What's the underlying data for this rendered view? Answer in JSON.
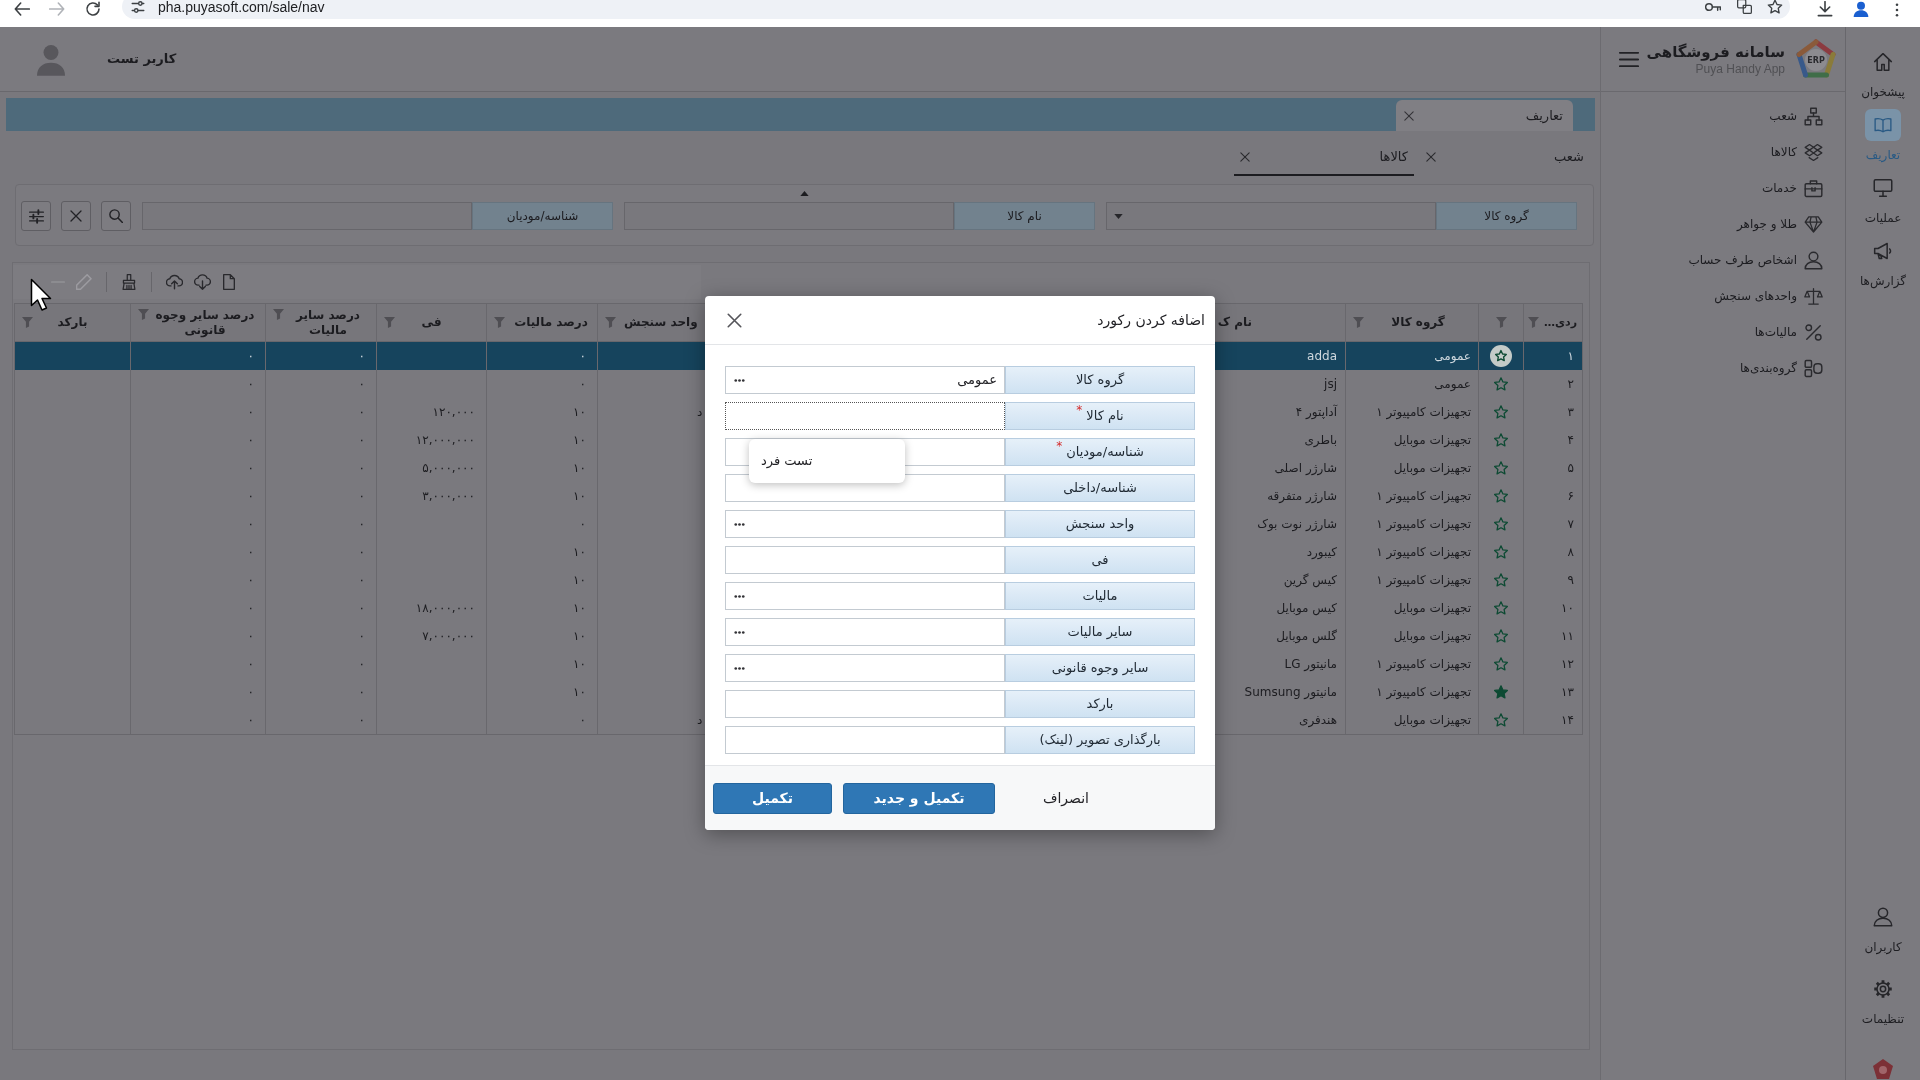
{
  "browser": {
    "url": "pha.puyasoft.com/sale/nav"
  },
  "brand": {
    "logo_text": "ERP",
    "title": "سامانه فروشگاهی",
    "subtitle": "Puya Handy App"
  },
  "rail": {
    "items": [
      {
        "label": "پیشخوان",
        "selected": false
      },
      {
        "label": "تعاریف",
        "selected": true
      },
      {
        "label": "عملیات",
        "selected": false
      },
      {
        "label": "گزارش‌ها",
        "selected": false
      }
    ],
    "bottom_items": [
      {
        "label": "کاربران",
        "selected": false
      },
      {
        "label": "تنظیمات",
        "selected": false
      }
    ]
  },
  "submenu": {
    "items": [
      "شعب",
      "کالاها",
      "خدمات",
      "طلا و جواهر",
      "اشخاص طرف حساب",
      "واحدهای سنجش",
      "مالیات‌ها",
      "گروه‌بندی‌ها"
    ]
  },
  "header": {
    "user_name": "کاربر تست"
  },
  "page_tabs": [
    {
      "label": "تعاریف",
      "selected": true
    }
  ],
  "sub_tabs": [
    {
      "label": "شعب",
      "selected": false
    },
    {
      "label": "کالاها",
      "selected": true
    }
  ],
  "filter": {
    "fields": [
      {
        "label": "گروه کالا",
        "kind": "dropdown"
      },
      {
        "label": "نام کالا",
        "kind": "text"
      },
      {
        "label": "شناسه/مودیان",
        "kind": "text"
      }
    ]
  },
  "toolbar": [
    {
      "disabled": true
    },
    {
      "disabled": true
    },
    {
      "disabled": false
    },
    {
      "disabled": false
    },
    {
      "disabled": false
    },
    {
      "disabled": false
    }
  ],
  "table": {
    "columns": [
      {
        "label": "ردی…",
        "filter": true
      },
      {
        "filter": true
      },
      {
        "label": "گروه کالا",
        "filter": true
      },
      {
        "label": "نام ک",
        "filter": false
      },
      {
        "label": "واحد سنجش",
        "filter": true
      },
      {
        "label": "درصد مالیات",
        "filter": true
      },
      {
        "label": "فی",
        "filter": true
      },
      {
        "label": "درصد سایر مالیات",
        "filter": true
      },
      {
        "label": "درصد سایر وجوه قانونی",
        "filter": true
      },
      {
        "label": "بارکد",
        "filter": true
      }
    ],
    "rows": [
      {
        "number": "۱",
        "favorite": false,
        "selected": true,
        "group": "عمومی",
        "name": "adda",
        "tax_percent": "۰",
        "other_tax_percent": "۰",
        "other_legal_percent": "۰"
      },
      {
        "number": "۲",
        "favorite": false,
        "selected": false,
        "group": "عمومی",
        "name": "jsj",
        "tax_percent": "۰",
        "other_tax_percent": "۰",
        "other_legal_percent": "۰"
      },
      {
        "number": "۳",
        "favorite": false,
        "selected": false,
        "group": "تجهیزات کامپیوتر ۱",
        "name": "آداپتور ۴",
        "unit": "د",
        "tax_percent": "۱۰",
        "price": "۱۲۰,۰۰۰",
        "other_tax_percent": "۰",
        "other_legal_percent": "۰"
      },
      {
        "number": "۴",
        "favorite": false,
        "selected": false,
        "group": "تجهیزات موبایل",
        "name": "باطری",
        "tax_percent": "۱۰",
        "price": "۱۲,۰۰۰,۰۰۰",
        "other_tax_percent": "۰",
        "other_legal_percent": "۰"
      },
      {
        "number": "۵",
        "favorite": false,
        "selected": false,
        "group": "تجهیزات موبایل",
        "name": "شارژر اصلی",
        "tax_percent": "۱۰",
        "price": "۵,۰۰۰,۰۰۰",
        "other_tax_percent": "۰",
        "other_legal_percent": "۰"
      },
      {
        "number": "۶",
        "favorite": false,
        "selected": false,
        "group": "تجهیزات کامپیوتر ۱",
        "name": "شارژر متفرقه",
        "tax_percent": "۱۰",
        "price": "۳,۰۰۰,۰۰۰",
        "other_tax_percent": "۰",
        "other_legal_percent": "۰"
      },
      {
        "number": "۷",
        "favorite": false,
        "selected": false,
        "group": "تجهیزات کامپیوتر ۱",
        "name": "شارژر نوت بوک",
        "tax_percent": "۰",
        "other_tax_percent": "۰",
        "other_legal_percent": "۰"
      },
      {
        "number": "۸",
        "favorite": false,
        "selected": false,
        "group": "تجهیزات کامپیوتر ۱",
        "name": "کیبورد",
        "tax_percent": "۱۰",
        "other_tax_percent": "۰",
        "other_legal_percent": "۰"
      },
      {
        "number": "۹",
        "favorite": false,
        "selected": false,
        "group": "تجهیزات کامپیوتر ۱",
        "name": "کیس گرین",
        "tax_percent": "۱۰",
        "other_tax_percent": "۰",
        "other_legal_percent": "۰"
      },
      {
        "number": "۱۰",
        "favorite": false,
        "selected": false,
        "group": "تجهیزات موبایل",
        "name": "کیس موبایل",
        "tax_percent": "۱۰",
        "price": "۱۸,۰۰۰,۰۰۰",
        "other_tax_percent": "۰",
        "other_legal_percent": "۰"
      },
      {
        "number": "۱۱",
        "favorite": false,
        "selected": false,
        "group": "تجهیزات موبایل",
        "name": "گلس موبایل",
        "tax_percent": "۱۰",
        "price": "۷,۰۰۰,۰۰۰",
        "other_tax_percent": "۰",
        "other_legal_percent": "۰"
      },
      {
        "number": "۱۲",
        "favorite": false,
        "selected": false,
        "group": "تجهیزات کامپیوتر ۱",
        "name": "مانیتور LG",
        "tax_percent": "۱۰",
        "other_tax_percent": "۰",
        "other_legal_percent": "۰"
      },
      {
        "number": "۱۳",
        "favorite": true,
        "selected": false,
        "group": "تجهیزات کامپیوتر ۱",
        "name": "مانیتور Sumsung",
        "tax_percent": "۱۰",
        "other_tax_percent": "۰",
        "other_legal_percent": "۰"
      },
      {
        "number": "۱۴",
        "favorite": false,
        "selected": false,
        "group": "تجهیزات موبایل",
        "name": "هندفری",
        "unit": "د",
        "tax_percent": "۰",
        "other_tax_percent": "۰",
        "other_legal_percent": "۰"
      }
    ]
  },
  "dialog": {
    "title": "اضافه کردن رکورد",
    "fields": [
      {
        "label": "گروه کالا",
        "value": "عمومی",
        "lookup": true,
        "focused": false
      },
      {
        "label": "نام کالا$^{*}$",
        "lookup": false,
        "focused": true
      },
      {
        "label": "شناسه/مودیان$^{*}$",
        "lookup": false,
        "focused": false
      },
      {
        "label": "شناسه/داخلی",
        "lookup": false,
        "focused": false
      },
      {
        "label": "واحد سنجش",
        "lookup": true,
        "focused": false
      },
      {
        "label": "فی",
        "lookup": false,
        "focused": false
      },
      {
        "label": "مالیات",
        "lookup": true,
        "focused": false
      },
      {
        "label": "سایر مالیات",
        "lookup": true,
        "focused": false
      },
      {
        "label": "سایر وجوه قانونی",
        "lookup": true,
        "focused": false
      },
      {
        "label": "بارکد",
        "lookup": false,
        "focused": false
      },
      {
        "label": "بارگذاری تصویر (لینک)",
        "lookup": false,
        "focused": false
      }
    ],
    "suggestions": [
      "تست فرد"
    ],
    "buttons": [
      {
        "label": "انصراف",
        "kind": "link"
      },
      {
        "label": "تکمیل و جدید",
        "kind": "primary"
      },
      {
        "label": "تکمیل",
        "kind": "primary"
      }
    ]
  }
}
